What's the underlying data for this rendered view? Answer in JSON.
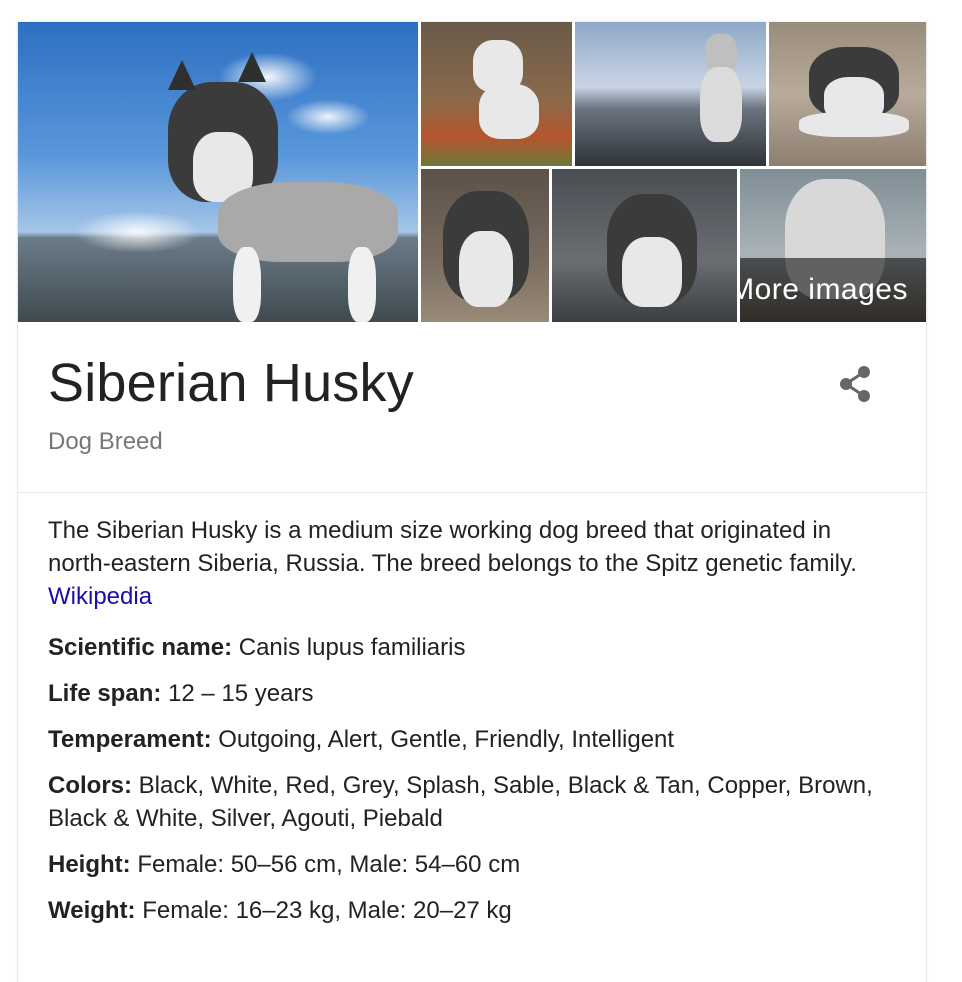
{
  "gallery": {
    "more_images_label": "More images"
  },
  "entity": {
    "title": "Siberian Husky",
    "subtitle": "Dog Breed"
  },
  "description": {
    "text": "The Siberian Husky is a medium size working dog breed that originated in north-eastern Siberia, Russia. The breed belongs to the Spitz genetic family.",
    "source_link": "Wikipedia"
  },
  "facts": [
    {
      "label": "Scientific name:",
      "value": "Canis lupus familiaris"
    },
    {
      "label": "Life span:",
      "value": "12 – 15 years"
    },
    {
      "label": "Temperament:",
      "value": "Outgoing, Alert, Gentle, Friendly, Intelligent"
    },
    {
      "label": "Colors:",
      "value": "Black, White, Red, Grey, Splash, Sable, Black & Tan, Copper, Brown, Black & White, Silver, Agouti, Piebald"
    },
    {
      "label": "Height:",
      "value": "Female: 50–56 cm, Male: 54–60 cm"
    },
    {
      "label": "Weight:",
      "value": "Female: 16–23 kg, Male: 20–27 kg"
    }
  ],
  "icons": {
    "share": "share-icon"
  },
  "colors": {
    "link": "#1a0dab",
    "subtitle": "#777777",
    "text": "#222222"
  }
}
